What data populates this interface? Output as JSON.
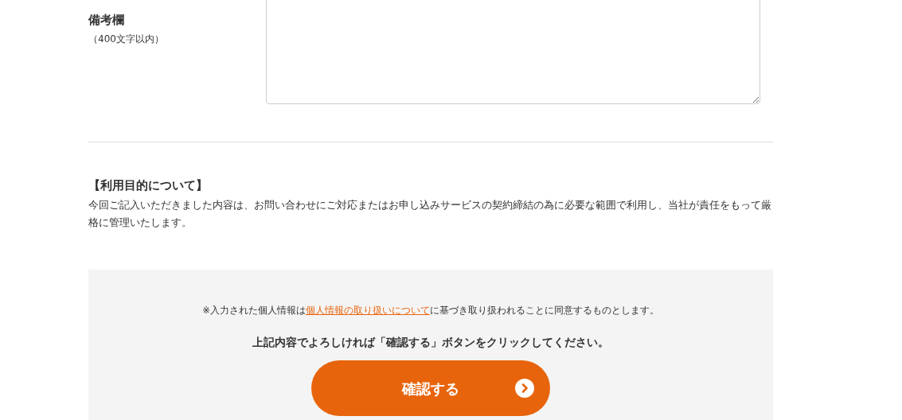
{
  "remarks": {
    "label": "備考欄",
    "note": "（400文字以内）"
  },
  "purpose": {
    "heading": "【利用目的について】",
    "text": "今回ご記入いただきました内容は、お問い合わせにご対応またはお申し込みサービスの契約締結の為に必要な範囲で利用し、当社が責任をもって厳格に管理いたします。"
  },
  "consent": {
    "before": "※入力された個人情報は",
    "link": "個人情報の取り扱いについて",
    "after": "に基づき取り扱われることに同意するものとします。",
    "instruction": "上記内容でよろしければ「確認する」ボタンをクリックしてください。",
    "button": "確認する"
  }
}
